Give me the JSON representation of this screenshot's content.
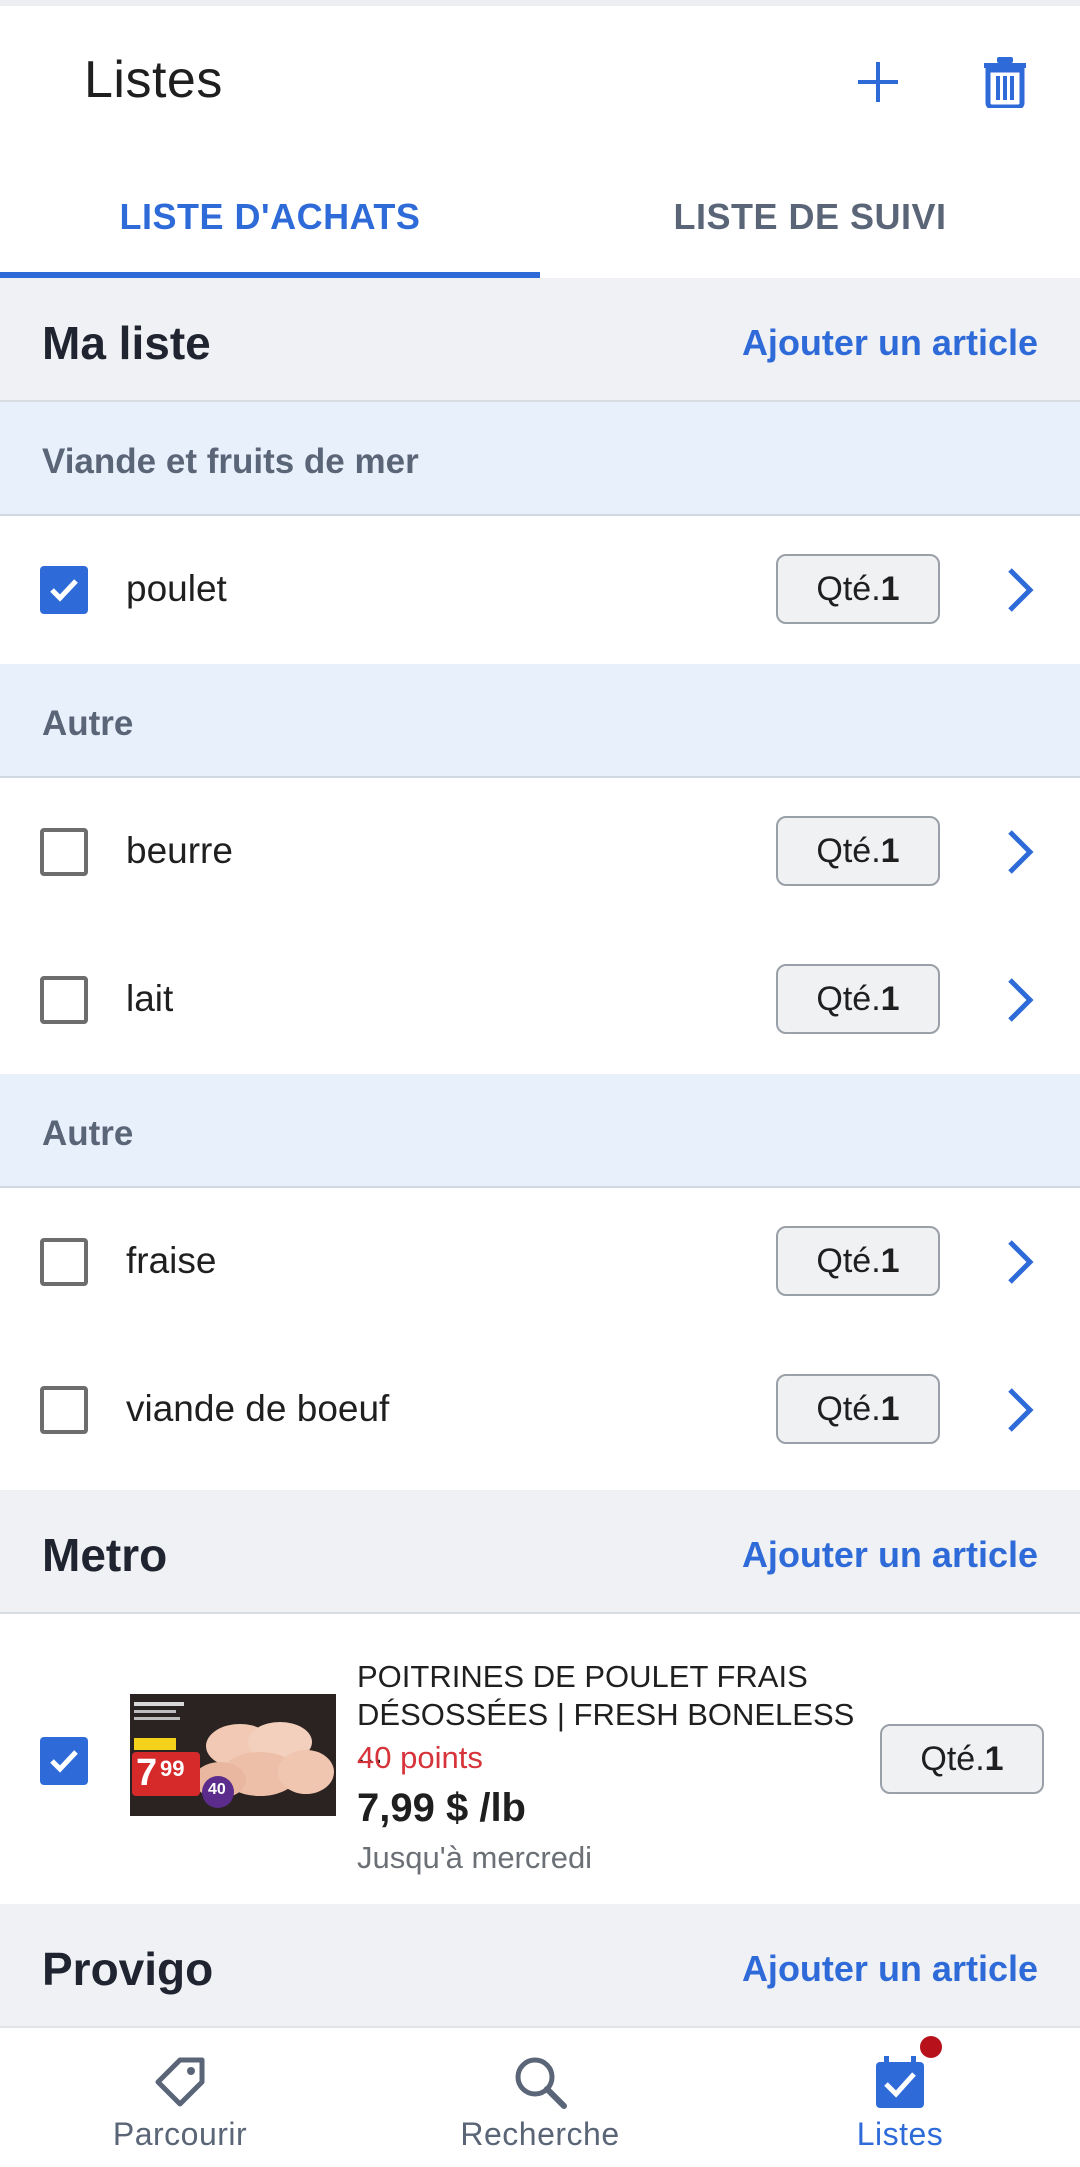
{
  "appbar": {
    "title": "Listes"
  },
  "tabs": [
    {
      "label": "LISTE D'ACHATS",
      "active": true
    },
    {
      "label": "LISTE DE SUIVI",
      "active": false
    }
  ],
  "my_list": {
    "name": "Ma liste",
    "add_label": "Ajouter un article",
    "groups": [
      {
        "category": "Viande et fruits de mer",
        "items": [
          {
            "label": "poulet",
            "checked": true,
            "qty_prefix": "Qté.",
            "qty": "1"
          }
        ]
      },
      {
        "category": "Autre",
        "items": [
          {
            "label": "beurre",
            "checked": false,
            "qty_prefix": "Qté.",
            "qty": "1"
          },
          {
            "label": "lait",
            "checked": false,
            "qty_prefix": "Qté.",
            "qty": "1"
          }
        ]
      },
      {
        "category": "Autre",
        "items": [
          {
            "label": "fraise",
            "checked": false,
            "qty_prefix": "Qté.",
            "qty": "1"
          },
          {
            "label": "viande de boeuf",
            "checked": false,
            "qty_prefix": "Qté.",
            "qty": "1"
          }
        ]
      }
    ]
  },
  "metro": {
    "name": "Metro",
    "add_label": "Ajouter un article",
    "product": {
      "name": "POITRINES DE POULET FRAIS DÉSOSSÉES | FRESH BONELESS ...",
      "points": "40 points",
      "price": "7,99 $ /lb",
      "until": "Jusqu'à mercredi",
      "checked": true,
      "qty_prefix": "Qté.",
      "qty": "1",
      "thumb_price": "7",
      "thumb_cents": "99",
      "thumb_badge": "40"
    }
  },
  "provigo": {
    "name": "Provigo",
    "add_label": "Ajouter un article"
  },
  "bottom_nav": [
    {
      "label": "Parcourir",
      "icon": "tag-icon",
      "active": false
    },
    {
      "label": "Recherche",
      "icon": "search-icon",
      "active": false
    },
    {
      "label": "Listes",
      "icon": "list-check-icon",
      "active": true
    }
  ],
  "colors": {
    "accent": "#2f6bd8",
    "category_bg": "#e8f0fb",
    "section_bg": "#f0f1f4",
    "points": "#d6333a",
    "badge": "#b7121c"
  }
}
